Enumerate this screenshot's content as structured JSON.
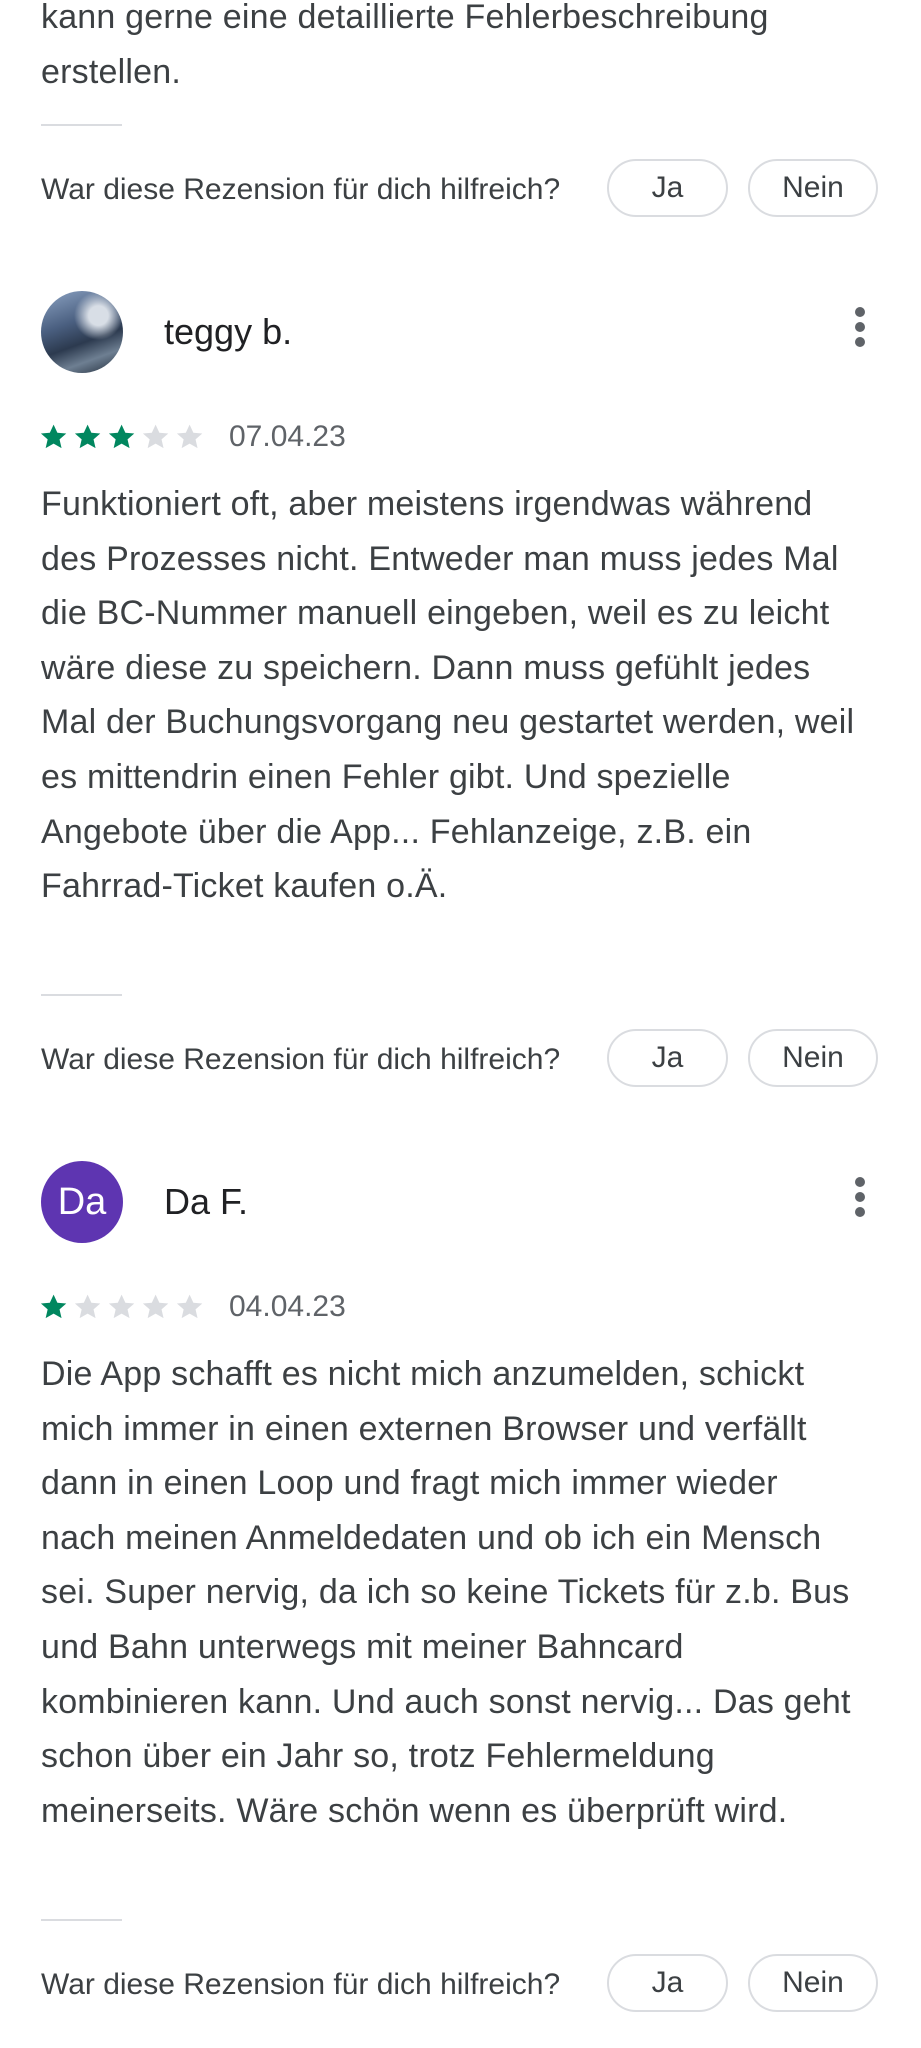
{
  "reviews": [
    {
      "text": "kann gerne eine detaillierte Fehlerbeschreibung erstellen.",
      "helpful": {
        "question": "War diese Rezension für dich hilfreich?",
        "yes": "Ja",
        "no": "Nein"
      }
    },
    {
      "author": "teggy b.",
      "avatar": "photo-avatar",
      "rating": 3,
      "date": "07.04.23",
      "text": "Funktioniert oft, aber meistens irgendwas während des Prozesses nicht. Entweder man muss jedes Mal die BC-Nummer manuell eingeben, weil es zu leicht wäre diese zu speichern. Dann muss gefühlt jedes Mal der Buchungsvorgang neu gestartet werden, weil es mittendrin einen Fehler gibt. Und spezielle Angebote über die App... Fehlanzeige, z.B. ein Fahrrad-Ticket kaufen o.Ä.",
      "helpful": {
        "question": "War diese Rezension für dich hilfreich?",
        "yes": "Ja",
        "no": "Nein"
      }
    },
    {
      "author": "Da F.",
      "avatar_initials": "Da",
      "avatar_color": "#5e35b1",
      "rating": 1,
      "date": "04.04.23",
      "text": "Die App schafft es nicht mich anzumelden, schickt mich immer in einen externen Browser und verfällt dann in einen Loop und fragt mich immer wieder nach meinen Anmeldedaten und ob ich ein Mensch sei. Super nervig, da ich so keine Tickets für z.b. Bus und Bahn unterwegs mit meiner Bahncard kombinieren kann. Und auch sonst nervig... Das geht schon über ein Jahr so, trotz Fehlermeldung meinerseits. Wäre schön wenn es überprüft wird.",
      "helpful": {
        "question": "War diese Rezension für dich hilfreich?",
        "yes": "Ja",
        "no": "Nein"
      }
    }
  ],
  "colors": {
    "star_filled": "#01875f",
    "star_empty": "#dadce0",
    "more_icon": "#5f6368"
  },
  "icons": {
    "more": "more-vert-icon",
    "star": "star-icon"
  }
}
